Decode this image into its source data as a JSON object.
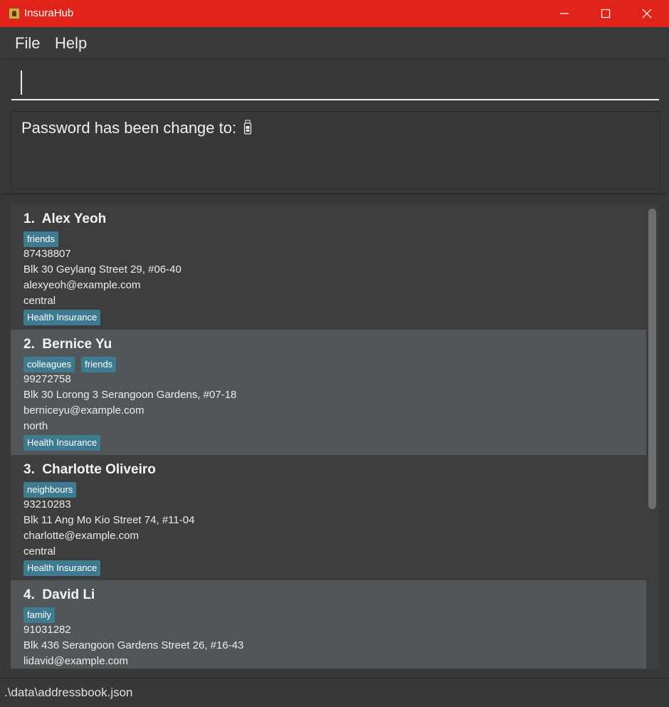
{
  "window": {
    "title": "InsuraHub"
  },
  "menu": {
    "file": "File",
    "help": "Help"
  },
  "command_box": {
    "value": ""
  },
  "result": {
    "message": "Password has been change to: "
  },
  "persons": [
    {
      "index": "1.",
      "name": "Alex Yeoh",
      "tags": [
        "friends"
      ],
      "phone": "87438807",
      "address": "Blk 30 Geylang Street 29, #06-40",
      "email": "alexyeoh@example.com",
      "region": "central",
      "policy": "Health Insurance"
    },
    {
      "index": "2.",
      "name": "Bernice Yu",
      "tags": [
        "colleagues",
        "friends"
      ],
      "phone": "99272758",
      "address": "Blk 30 Lorong 3 Serangoon Gardens, #07-18",
      "email": "berniceyu@example.com",
      "region": "north",
      "policy": "Health Insurance"
    },
    {
      "index": "3.",
      "name": "Charlotte Oliveiro",
      "tags": [
        "neighbours"
      ],
      "phone": "93210283",
      "address": "Blk 11 Ang Mo Kio Street 74, #11-04",
      "email": "charlotte@example.com",
      "region": "central",
      "policy": "Health Insurance"
    },
    {
      "index": "4.",
      "name": "David Li",
      "tags": [
        "family"
      ],
      "phone": "91031282",
      "address": "Blk 436 Serangoon Gardens Street 26, #16-43",
      "email": "lidavid@example.com",
      "region": "",
      "policy": ""
    }
  ],
  "status": {
    "file_path": ".\\data\\addressbook.json"
  },
  "colors": {
    "titlebar": "#e0241c",
    "tag": "#3e7b91",
    "card_odd": "#3c3e3f",
    "card_even": "#515658"
  }
}
